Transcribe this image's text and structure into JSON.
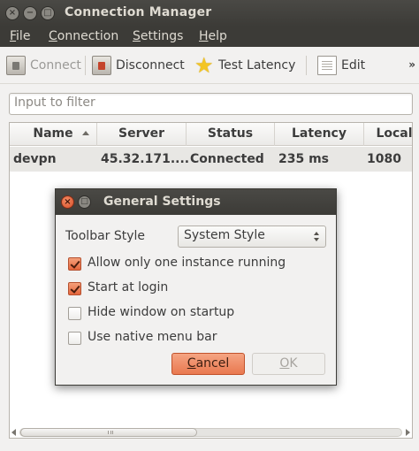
{
  "window": {
    "title": "Connection Manager",
    "close_glyph": "×",
    "min_glyph": "−",
    "max_glyph": "□"
  },
  "menubar": {
    "items": [
      {
        "label_first": "F",
        "label_rest": "ile"
      },
      {
        "label_first": "C",
        "label_rest": "onnection"
      },
      {
        "label_first": "S",
        "label_rest": "ettings"
      },
      {
        "label_first": "H",
        "label_rest": "elp"
      }
    ]
  },
  "toolbar": {
    "connect_label": "Connect",
    "disconnect_label": "Disconnect",
    "test_latency_label": "Test Latency",
    "edit_label": "Edit",
    "overflow_glyph": "»",
    "star_glyph": "★"
  },
  "filter": {
    "placeholder": "Input to filter"
  },
  "table": {
    "columns": [
      "Name",
      "Server",
      "Status",
      "Latency",
      "Local"
    ],
    "rows": [
      {
        "name": "devpn",
        "server": "45.32.171....",
        "status": "Connected",
        "latency": "235 ms",
        "local": "1080"
      }
    ]
  },
  "dialog": {
    "title": "General Settings",
    "close_glyph": "×",
    "max_glyph": "□",
    "toolbar_style_label": "Toolbar Style",
    "toolbar_style_value": "System Style",
    "options": [
      {
        "label": "Allow only one instance running",
        "checked": true
      },
      {
        "label": "Start at login",
        "checked": true
      },
      {
        "label": "Hide window on startup",
        "checked": false
      },
      {
        "label": "Use native menu bar",
        "checked": false
      }
    ],
    "cancel_first": "C",
    "cancel_rest": "ancel",
    "ok_first": "O",
    "ok_rest": "K"
  },
  "colors": {
    "accent": "#e9784f",
    "titlebar": "#3c3b37",
    "selection_row": "#e8e7e4"
  }
}
